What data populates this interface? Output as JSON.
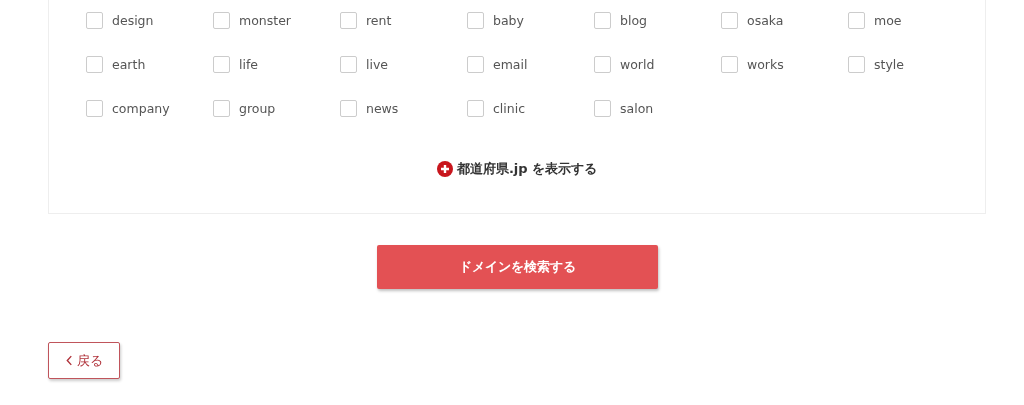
{
  "domains": [
    {
      "label": "design",
      "checked": false
    },
    {
      "label": "monster",
      "checked": false
    },
    {
      "label": "rent",
      "checked": false
    },
    {
      "label": "baby",
      "checked": false
    },
    {
      "label": "blog",
      "checked": false
    },
    {
      "label": "osaka",
      "checked": false
    },
    {
      "label": "moe",
      "checked": false
    },
    {
      "label": "earth",
      "checked": false
    },
    {
      "label": "life",
      "checked": false
    },
    {
      "label": "live",
      "checked": false
    },
    {
      "label": "email",
      "checked": false
    },
    {
      "label": "world",
      "checked": false
    },
    {
      "label": "works",
      "checked": false
    },
    {
      "label": "style",
      "checked": false
    },
    {
      "label": "company",
      "checked": false
    },
    {
      "label": "group",
      "checked": false
    },
    {
      "label": "news",
      "checked": false
    },
    {
      "label": "clinic",
      "checked": false
    },
    {
      "label": "salon",
      "checked": false
    }
  ],
  "expand_link": "都道府県.jp を表示する",
  "search_button": "ドメインを検索する",
  "back_button": "戻る"
}
